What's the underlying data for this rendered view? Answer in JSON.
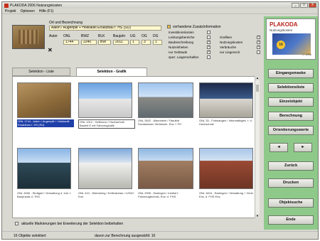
{
  "window": {
    "title": "PLAKODA 2006 Nutzungskosten",
    "controls": [
      "_",
      "□",
      "X"
    ]
  },
  "menu": [
    "Projekt",
    "Optionen",
    "Hilfe (F1)"
  ],
  "object": {
    "heading": "Ort und Bezeichnung",
    "name": "Aalen / Augenpilt + Hokkaolit Ersatzbau f. HS (SU)",
    "col_labels": [
      "Autor",
      "ONL",
      "BWZ",
      "BLK",
      "Baujahr",
      "UG",
      "OG",
      "DG"
    ],
    "values": [
      "1744",
      "2240",
      "BW",
      "2011",
      "1",
      "3",
      "1"
    ]
  },
  "zusatz": {
    "heading": "vorhandene Zusatzinformation",
    "left_items": [
      "Investitionskosten",
      "Leistungsbereiche",
      "Baubeschreibung",
      "Nutzeinheiten",
      "nur Gebäude",
      "spez. Liegenschaften"
    ],
    "right_items": [
      "Grafiken",
      "Nutzungskosten",
      "Verbräuche",
      "nur Liegensch."
    ]
  },
  "tabs": {
    "list": "Selektion - Liste",
    "graphic": "Selektion - Grafik"
  },
  "gallery": [
    {
      "caption": "ONL 1744 - Aalen / Augenpilt + Hokkaolit Ersatzbau f. HS (SU)",
      "style": "selected"
    },
    {
      "caption": "ONL 1312 - Heilbronn / Hochschule Bauteil E mit Fahrzeughalle",
      "style": "boxed"
    },
    {
      "caption": "ONL 2602 - Mannheim / Fakultät Sozialwesen Verbesser. Erw. f. FH",
      "style": "plain"
    },
    {
      "caption": "ONL 33 - Furtwangen / Informatikgeb. f. d. Hochschule",
      "style": "plain"
    },
    {
      "caption": "ONL 3266 - Stuttgart / Verwaltung d. Inst. f. Bauphysik d. THS",
      "style": "plain"
    },
    {
      "caption": "ONL 410 - Weinsberg / Kelleranbau / LVWO Erw.",
      "style": "plain"
    },
    {
      "caption": "ONL 2906 - Esslingen / Institut f. Fahrzeugtechnik, Erw. d. FHS",
      "style": "plain"
    },
    {
      "caption": "ONL 3404 - Esslingen / Verwaltung + Zentr. Erw. d. FHS Erw.",
      "style": "plain"
    }
  ],
  "footer": {
    "checkbox_label": "aktuelle Markierungen bei Erweiterung der Selektion beibehalten",
    "status_left": "16 Objekte selektiert",
    "status_right": "davon zur Berechnung ausgewählt: 16"
  },
  "logo": {
    "title": "PLAKODA",
    "subtitle": "Nutzungskosten",
    "badge": "16",
    "version": "1 / 2006"
  },
  "buttons": {
    "eingabemaske": "Eingangsmaske",
    "selektionsliste": "Selektionsliste",
    "einzelobjekt": "Einzelobjekt",
    "berechnung": "Berechnung",
    "orientierungswerte": "Orientierungswerte",
    "prev": "◄",
    "next": "►",
    "zurueck": "Zurück",
    "drucken": "Drucken",
    "objektsuche": "Objektsuche",
    "ende": "Ende"
  }
}
